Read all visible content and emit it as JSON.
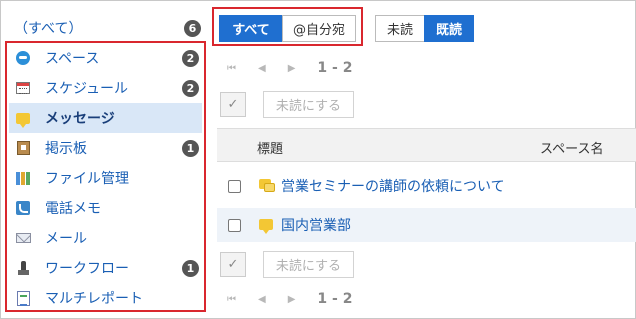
{
  "sidebar": {
    "all": {
      "label": "（すべて）",
      "badge": "6"
    },
    "items": [
      {
        "label": "スペース",
        "badge": "2",
        "icon": "space-icon"
      },
      {
        "label": "スケジュール",
        "badge": "2",
        "icon": "calendar-icon"
      },
      {
        "label": "メッセージ",
        "badge": "",
        "icon": "message-icon",
        "selected": true
      },
      {
        "label": "掲示板",
        "badge": "1",
        "icon": "bulletin-board-icon"
      },
      {
        "label": "ファイル管理",
        "badge": "",
        "icon": "file-management-icon"
      },
      {
        "label": "電話メモ",
        "badge": "",
        "icon": "phone-memo-icon"
      },
      {
        "label": "メール",
        "badge": "",
        "icon": "mail-icon"
      },
      {
        "label": "ワークフロー",
        "badge": "1",
        "icon": "workflow-icon"
      },
      {
        "label": "マルチレポート",
        "badge": "",
        "icon": "multi-report-icon"
      }
    ]
  },
  "filters": {
    "all_label": "すべて",
    "mention_label": "@自分宛",
    "unread_label": "未読",
    "read_label": "既読"
  },
  "pager": {
    "range": "1 - 2",
    "first": "first-page-icon",
    "prev": "prev-page-icon",
    "next": "next-page-icon"
  },
  "actions": {
    "check_all": "✓",
    "mark_unread": "未読にする"
  },
  "table": {
    "headers": {
      "title": "標題",
      "space": "スペース名"
    },
    "rows": [
      {
        "title": "営業セミナーの講師の依頼について"
      },
      {
        "title": "国内営業部"
      }
    ]
  },
  "colors": {
    "accent": "#1f6fd0",
    "highlight_border": "#d9272e",
    "link": "#1a5fb4",
    "selected_bg": "#d9e7f7"
  }
}
